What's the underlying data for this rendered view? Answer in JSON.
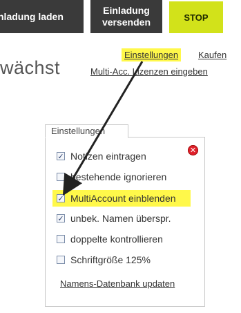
{
  "toolbar": {
    "load_label": "nladung laden",
    "send_label_line1": "Einladung",
    "send_label_line2": "versenden",
    "stop_label": "STOP"
  },
  "page": {
    "headline": "wächst",
    "links": {
      "settings": "Einstellungen",
      "buy": "Kaufen",
      "multi": "Multi-Acc. Lizenzen eingeben"
    }
  },
  "settings_panel": {
    "tab_label": "Einstellungen",
    "close_icon": "close-icon",
    "options": [
      {
        "label": "Notizen eintragen",
        "checked": true
      },
      {
        "label": "bestehende ignorieren",
        "checked": false
      },
      {
        "label": "MultiAccount einblenden",
        "checked": true,
        "highlighted": true
      },
      {
        "label": "unbek. Namen überspr.",
        "checked": true
      },
      {
        "label": "doppelte kontrollieren",
        "checked": false
      },
      {
        "label": "Schriftgröße 125%",
        "checked": false
      }
    ],
    "update_link": "Namens-Datenbank updaten"
  },
  "colors": {
    "highlight": "#fff84a",
    "stop_button": "#d2e21a",
    "dark_button": "#3a3a3a",
    "close_red": "#e0202a"
  }
}
